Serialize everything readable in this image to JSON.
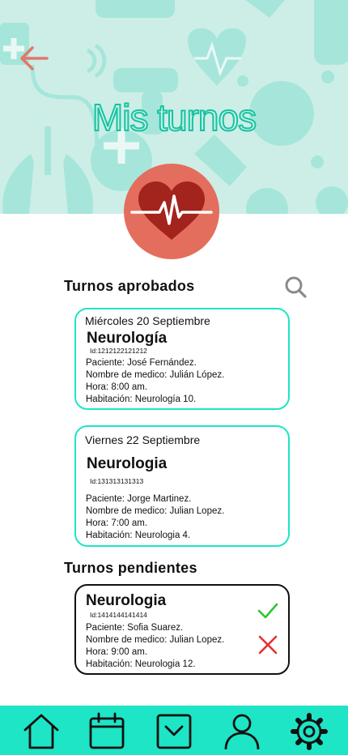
{
  "header": {
    "title": "Mis turnos"
  },
  "approved": {
    "title": "Turnos  aprobados",
    "cards": [
      {
        "date": "Miércoles 20 Septiembre",
        "specialty": "Neurología",
        "id": "Id:1212122121212",
        "patient": "Paciente: José Fernández.",
        "doctor": "Nombre de medico: Julián López.",
        "time": "Hora: 8:00 am.",
        "room": "Habitación: Neurología 10."
      },
      {
        "date": "Viernes 22 Septiembre",
        "specialty": "Neurologia",
        "id": "Id:131313131313",
        "patient": "Paciente: Jorge Martinez.",
        "doctor": "Nombre de medico: Julian Lopez.",
        "time": "Hora: 7:00 am.",
        "room": "Habitación: Neurologia 4."
      }
    ]
  },
  "pending": {
    "title": "Turnos  pendientes",
    "cards": [
      {
        "specialty": "Neurologia",
        "id": "Id:1414144141414",
        "patient": "Paciente: Sofia Suarez.",
        "doctor": "Nombre de medico: Julian Lopez.",
        "time": "Hora: 9:00 am.",
        "room": "Habitación: Neurologia 12."
      }
    ]
  },
  "icons": {
    "back": "arrow-left-icon",
    "search": "search-icon",
    "accept": "check-icon",
    "reject": "close-icon",
    "nav": [
      "home-icon",
      "calendar-icon",
      "checkbox-icon",
      "user-icon",
      "gear-icon"
    ]
  },
  "colors": {
    "accent": "#1de5c6",
    "hero_bg": "#cdeee7",
    "logo_bg": "#e46e5d",
    "heart": "#a3231d",
    "back_arrow": "#e2776c",
    "accept": "#2fc52f",
    "reject": "#e53030"
  }
}
